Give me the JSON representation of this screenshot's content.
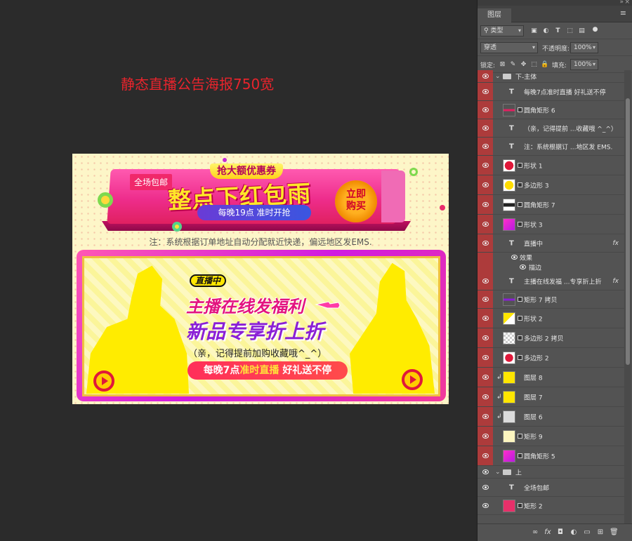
{
  "canvas": {
    "title": "静态直播公告海报750宽",
    "banner_top": {
      "badge": "全场包邮",
      "coupon": "抢大额优惠券",
      "headline": "整点下红包雨",
      "time_pill": "每晚19点  准时开抢",
      "buy_line1": "立即",
      "buy_line2": "购买",
      "note": "注：系统根据订单地址自动分配就近快递，偏远地区发EMS."
    },
    "banner_bottom": {
      "live_tag": "直播中",
      "host_title": "主播在线发福利",
      "new_title": "新品专享折上折",
      "reminder": "（亲，记得提前加购收藏哦^_^）",
      "daily_a": "每晚7点",
      "daily_b": "准时直播",
      "daily_c": "好礼送不停"
    },
    "colors": {
      "headline": "#ffe629",
      "accent_pink": "#e3147f",
      "accent_purple": "#8a1fd6",
      "frame": "#d01be0"
    }
  },
  "panel": {
    "tab": "图层",
    "filter_type": "类型",
    "blend_mode": "穿透",
    "opacity_label": "不透明度:",
    "opacity_value": "100%",
    "lock_label": "锁定:",
    "fill_label": "填充:",
    "fill_value": "100%",
    "layers": [
      {
        "name": "下-主体",
        "kind": "group"
      },
      {
        "name": "每晚7点准时直播  好礼送不停",
        "kind": "text"
      },
      {
        "name": "圆角矩形 6",
        "kind": "shape"
      },
      {
        "name": "（亲，记得提前 ...收藏哦 ^_^）",
        "kind": "text"
      },
      {
        "name": "注：系统根据订 ...地区发 EMS.",
        "kind": "text"
      },
      {
        "name": "形状 1",
        "kind": "shape"
      },
      {
        "name": "多边形 3",
        "kind": "shape"
      },
      {
        "name": "圆角矩形 7",
        "kind": "shape"
      },
      {
        "name": "形状 3",
        "kind": "shape"
      },
      {
        "name": "直播中",
        "kind": "text",
        "fx": "fx"
      },
      {
        "name": "效果",
        "kind": "effect"
      },
      {
        "name": "描边",
        "kind": "effect"
      },
      {
        "name": "主播在线发福 ...专享折上折",
        "kind": "text",
        "fx": "fx"
      },
      {
        "name": "矩形 7 拷贝",
        "kind": "shape"
      },
      {
        "name": "形状 2",
        "kind": "shape"
      },
      {
        "name": "多边形 2 拷贝",
        "kind": "shape"
      },
      {
        "name": "多边形 2",
        "kind": "shape"
      },
      {
        "name": "图层 8",
        "kind": "image"
      },
      {
        "name": "图层 7",
        "kind": "image"
      },
      {
        "name": "图层 6",
        "kind": "image"
      },
      {
        "name": "矩形 9",
        "kind": "shape"
      },
      {
        "name": "圆角矩形 5",
        "kind": "shape"
      },
      {
        "name": "上",
        "kind": "group"
      },
      {
        "name": "全场包邮",
        "kind": "text"
      },
      {
        "name": "矩形 2",
        "kind": "shape"
      }
    ],
    "icons": [
      "link-icon",
      "fx-icon",
      "mask-icon",
      "adjustment-icon",
      "folder-icon",
      "new-layer-icon",
      "trash-icon"
    ]
  }
}
